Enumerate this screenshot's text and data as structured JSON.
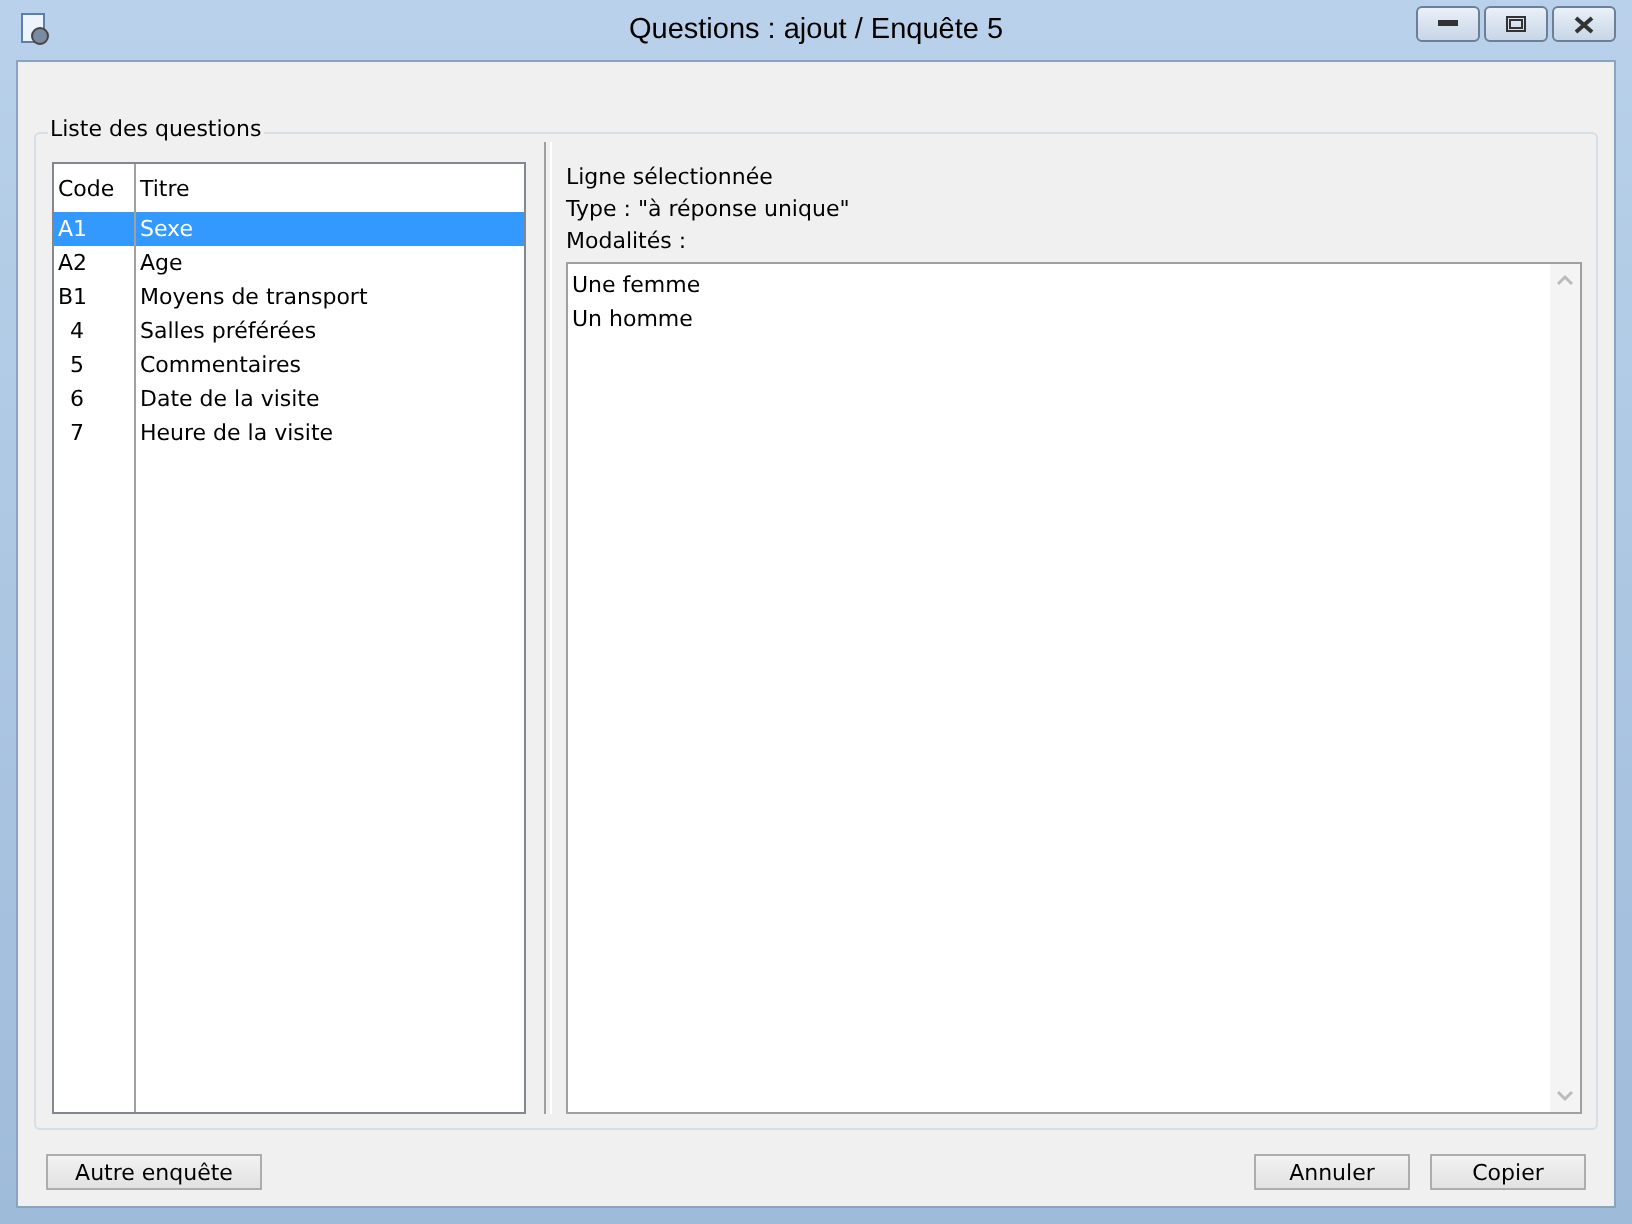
{
  "window": {
    "title": "Questions : ajout / Enquête 5"
  },
  "group_title": "Liste des questions",
  "table": {
    "columns": [
      "Code",
      "Titre"
    ],
    "rows": [
      {
        "code": "A1",
        "title": "Sexe",
        "selected": true
      },
      {
        "code": "A2",
        "title": "Age",
        "selected": false
      },
      {
        "code": "B1",
        "title": "Moyens de transport",
        "selected": false
      },
      {
        "code": "4",
        "title": "Salles préférées",
        "selected": false
      },
      {
        "code": "5",
        "title": "Commentaires",
        "selected": false
      },
      {
        "code": "6",
        "title": "Date de la visite",
        "selected": false
      },
      {
        "code": "7",
        "title": "Heure de la visite",
        "selected": false
      }
    ]
  },
  "details": {
    "heading": "Ligne sélectionnée",
    "type": "Type : \"à réponse unique\"",
    "modalities_label": "Modalités :",
    "modalities": [
      "Une femme",
      "Un homme"
    ]
  },
  "buttons": {
    "left": "Autre enquête",
    "cancel": "Annuler",
    "copy": "Copier"
  }
}
